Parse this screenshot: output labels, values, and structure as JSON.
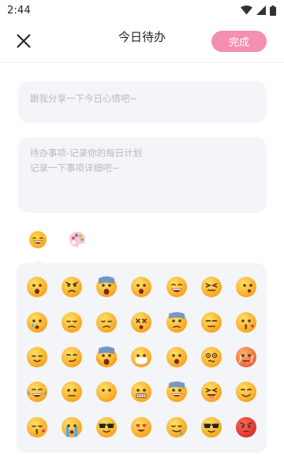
{
  "status_bar": {
    "time": "2:44",
    "icons": [
      "wifi-icon",
      "cellular-signal-icon",
      "battery-icon"
    ]
  },
  "header": {
    "close_icon": "close-icon",
    "title": "今日待办",
    "done_label": "完成"
  },
  "mood_input": {
    "placeholder": "跟我分享一下今日心情吧~"
  },
  "todo_input": {
    "placeholder_line1": "待办事项-记录你的每日计划",
    "placeholder_line2": "记录一下事项详细吧~"
  },
  "tabs": [
    {
      "icon": "emoji-tab-icon",
      "active": true
    },
    {
      "icon": "palette-tab-icon",
      "active": false
    }
  ],
  "colors": {
    "accent": "#f48fb1",
    "input_bg": "#f4f5f8",
    "placeholder": "#b7b9c0",
    "emoji_yellow": "#f9c22b"
  },
  "emoji_grid": [
    [
      "frowning-face",
      "angry-face",
      "fearful-face",
      "astonished-face",
      "grinning-face",
      "confounded-face",
      "frowning-side-eye-face"
    ],
    [
      "sad-tear-face",
      "pensive-face",
      "disappointed-face",
      "dizzy-face",
      "sweat-face",
      "expressionless-face",
      "kissing-face"
    ],
    [
      "relieved-face",
      "smirking-face",
      "screaming-face",
      "mask-face",
      "open-mouth-face",
      "spiral-eyes-face",
      "hot-face"
    ],
    [
      "laughing-tears-face",
      "neutral-face",
      "blank-face",
      "grimacing-face",
      "sweat-smile-face",
      "squinting-tongue-face",
      "smiling-face"
    ],
    [
      "kissing-closed-eyes-face",
      "crying-face",
      "sunglasses-face",
      "heart-eyes-face",
      "drooling-face",
      "cool-face",
      "red-angry-face"
    ]
  ]
}
